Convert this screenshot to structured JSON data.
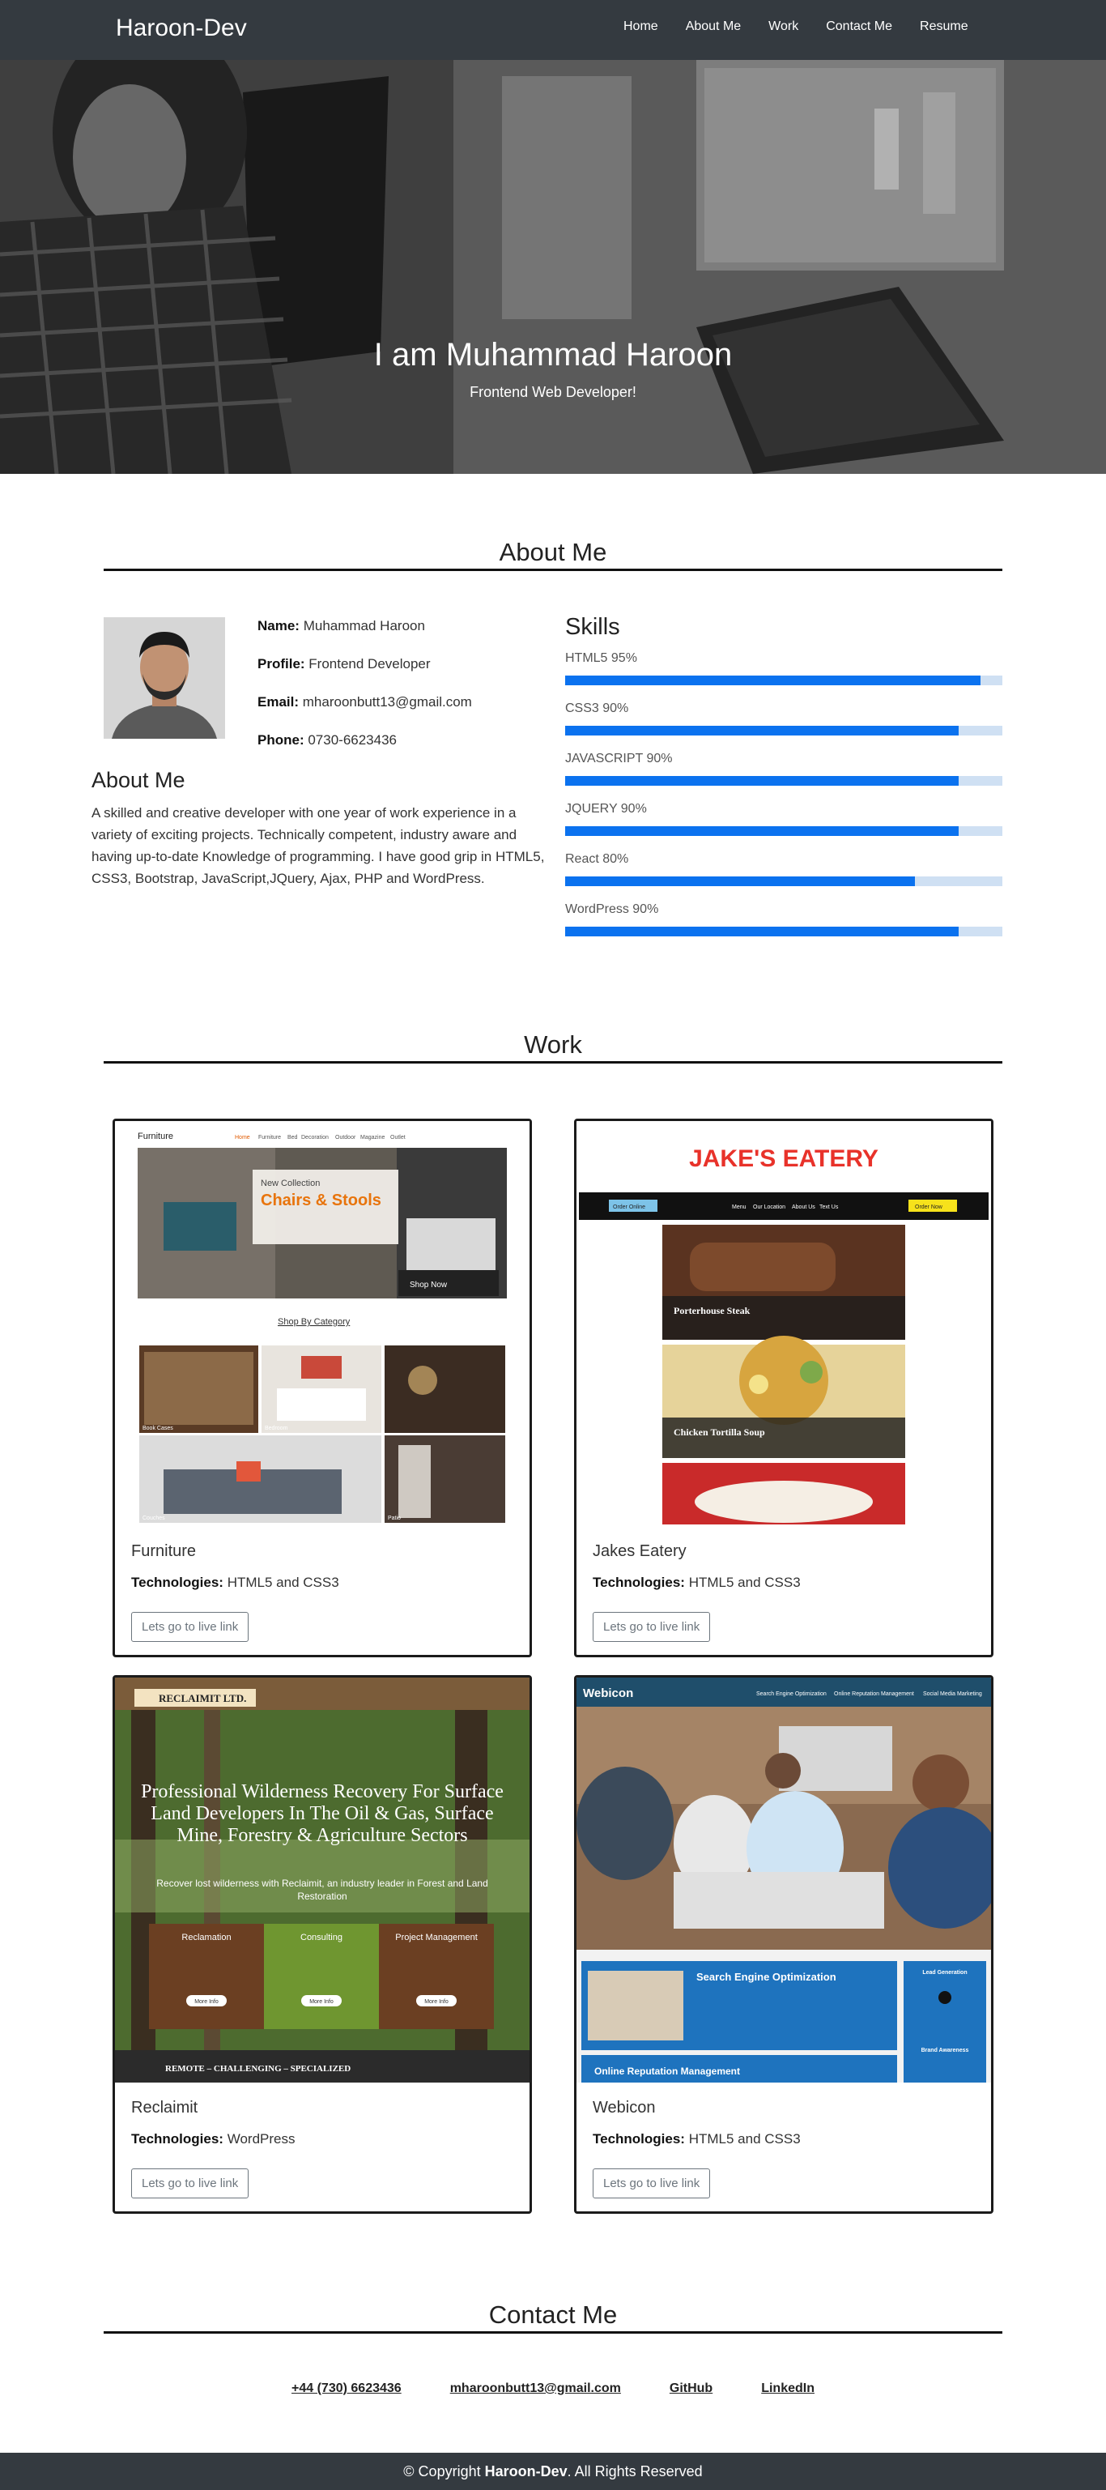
{
  "nav": {
    "brand": "Haroon-Dev",
    "links": [
      "Home",
      "About Me",
      "Work",
      "Contact Me",
      "Resume"
    ]
  },
  "hero": {
    "title": "I am Muhammad Haroon",
    "subtitle": "Frontend Web Developer!"
  },
  "about": {
    "section_title": "About Me",
    "name_label": "Name:",
    "name": "Muhammad Haroon",
    "profile_label": "Profile:",
    "profile": "Frontend Developer",
    "email_label": "Email:",
    "email": "mharoonbutt13@gmail.com",
    "phone_label": "Phone:",
    "phone": "0730-6623436",
    "heading": "About Me",
    "paragraph": "A skilled and creative developer with one year of work experience in a variety of exciting projects. Technically competent, industry aware and having up-to-date Knowledge of programming. I have good grip in HTML5, CSS3, Bootstrap, JavaScript,JQuery, Ajax, PHP and WordPress."
  },
  "skills": {
    "title": "Skills",
    "items": [
      {
        "label": "HTML5 95%",
        "value": 0.95
      },
      {
        "label": "CSS3 90%",
        "value": 0.9
      },
      {
        "label": "JAVASCRIPT 90%",
        "value": 0.9
      },
      {
        "label": "JQUERY 90%",
        "value": 0.9
      },
      {
        "label": "React 80%",
        "value": 0.8
      },
      {
        "label": "WordPress 90%",
        "value": 0.9
      }
    ]
  },
  "work": {
    "section_title": "Work",
    "tech_label": "Technologies:",
    "button_label": "Lets go to live link",
    "projects": [
      {
        "title": "Furniture",
        "tech": "HTML5 and CSS3",
        "shot": {
          "brand": "Furniture",
          "menu": [
            "Home",
            "Furniture",
            "Bed",
            "Decoration",
            "Outdoor",
            "Magazine",
            "Outlet"
          ],
          "kicker": "New Collection",
          "headline": "Chairs & Stools",
          "cta": "Shop Now",
          "category": "Shop By Category",
          "tiles": [
            "Book Cases",
            "Bedroom",
            "Couches",
            "Patio"
          ]
        }
      },
      {
        "title": "Jakes Eatery",
        "tech": "HTML5 and CSS3",
        "shot": {
          "logo": "JAKE'S EATERY",
          "order": "Order Online",
          "menu": [
            "Menu",
            "Our Location",
            "About Us",
            "Text Us"
          ],
          "order_now": "Order Now",
          "dishes": [
            "Porterhouse Steak",
            "Chicken Tortilla Soup"
          ]
        }
      },
      {
        "title": "Reclaimit",
        "tech": "WordPress",
        "shot": {
          "logo": "RECLAIMIT LTD.",
          "headline": "Professional Wilderness Recovery For Surface Land Developers In The Oil & Gas, Surface Mine, Forestry & Agriculture Sectors",
          "sub": "Recover lost wilderness with Reclaimit, an industry leader in Forest and Land Restoration",
          "boxes": [
            "Reclamation",
            "Consulting",
            "Project Management"
          ],
          "box_btn": "More Info",
          "tagline": "REMOTE – CHALLENGING – SPECIALIZED"
        }
      },
      {
        "title": "Webicon",
        "tech": "HTML5 and CSS3",
        "shot": {
          "logo": "Webicon",
          "menu": [
            "Search Engine Optimization",
            "Online Reputation Management",
            "Social Media Marketing"
          ],
          "panel1": "Search Engine Optimization",
          "panel2": "Online Reputation Management",
          "side1": "Lead Generation",
          "side2": "Brand Awareness"
        }
      }
    ]
  },
  "contact": {
    "section_title": "Contact Me",
    "links": [
      "+44 (730) 6623436",
      "mharoonbutt13@gmail.com",
      "GitHub",
      "LinkedIn"
    ]
  },
  "footer": {
    "prefix": "© Copyright ",
    "brand": "Haroon-Dev",
    "suffix": ". All Rights Reserved"
  },
  "colors": {
    "navbar": "#343a40",
    "skill_fill": "#0b72ef",
    "skill_track": "#cfe0f3"
  }
}
